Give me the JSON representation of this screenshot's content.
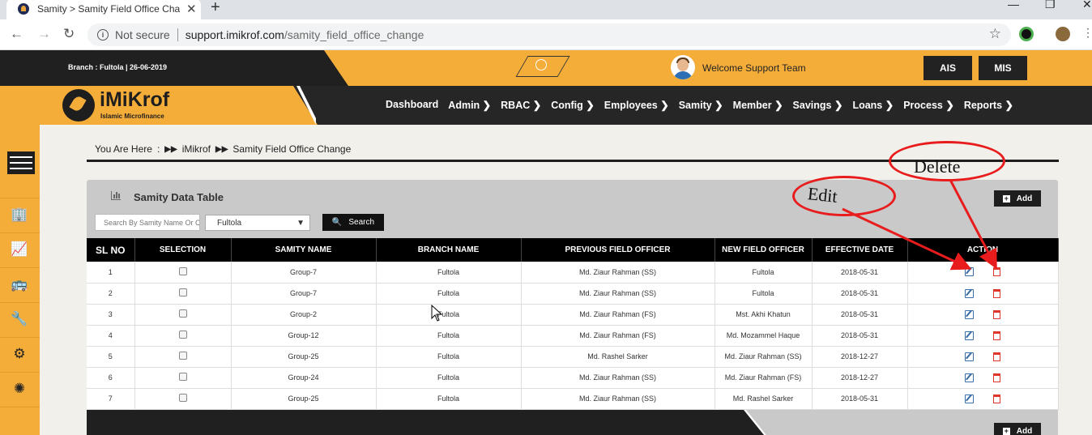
{
  "browser": {
    "tab_title": "Samity > Samity Field Office Cha",
    "url_security": "Not secure",
    "url_host": "support.imikrof.com",
    "url_path": "/samity_field_office_change"
  },
  "header": {
    "branch_info": "Branch : Fultola |  26-06-2019",
    "welcome": "Welcome Support Team",
    "buttons": [
      "AIS",
      "MIS"
    ],
    "logo_title": "iMiKrof",
    "logo_subtitle": "Islamic Microfinance"
  },
  "nav": [
    "Dashboard",
    "Admin",
    "RBAC",
    "Config",
    "Employees",
    "Samity",
    "Member",
    "Savings",
    "Loans",
    "Process",
    "Reports"
  ],
  "sidebar_icons": [
    "building-icon",
    "chart-icon",
    "bus-icon",
    "tools-icon",
    "cog-icon",
    "network-icon"
  ],
  "breadcrumb": {
    "label": "You Are Here",
    "sep": ":",
    "items": [
      "iMikrof",
      "Samity Field Office Change"
    ]
  },
  "panel": {
    "title": "Samity Data Table",
    "add_label": "Add",
    "search_placeholder": "Search By Samity Name Or Code",
    "branch_selected": "Fultola",
    "search_label": "Search"
  },
  "table": {
    "headers": [
      "SL NO",
      "SELECTION",
      "SAMITY NAME",
      "BRANCH NAME",
      "PREVIOUS FIELD OFFICER",
      "NEW FIELD OFFICER",
      "EFFECTIVE DATE",
      "ACTION"
    ],
    "rows": [
      [
        "1",
        "Group-7",
        "Fultola",
        "Md. Ziaur Rahman (SS)",
        "Fultola",
        "2018-05-31"
      ],
      [
        "2",
        "Group-7",
        "Fultola",
        "Md. Ziaur Rahman (SS)",
        "Fultola",
        "2018-05-31"
      ],
      [
        "3",
        "Group-2",
        "Fultola",
        "Md. Ziaur Rahman (FS)",
        "Mst. Akhi Khatun",
        "2018-05-31"
      ],
      [
        "4",
        "Group-12",
        "Fultola",
        "Md. Ziaur Rahman (FS)",
        "Md. Mozammel Haque",
        "2018-05-31"
      ],
      [
        "5",
        "Group-25",
        "Fultola",
        "Md. Rashel Sarker",
        "Md. Ziaur Rahman (SS)",
        "2018-12-27"
      ],
      [
        "6",
        "Group-24",
        "Fultola",
        "Md. Ziaur Rahman (SS)",
        "Md. Ziaur Rahman (FS)",
        "2018-12-27"
      ],
      [
        "7",
        "Group-25",
        "Fultola",
        "Md. Ziaur Rahman (SS)",
        "Md. Rashel Sarker",
        "2018-05-31"
      ]
    ]
  },
  "annotations": {
    "edit": "Edit",
    "delete": "Delete"
  },
  "colors": {
    "accent": "#f5ad3a",
    "dark": "#202020",
    "annotation": "#e81c1c"
  }
}
